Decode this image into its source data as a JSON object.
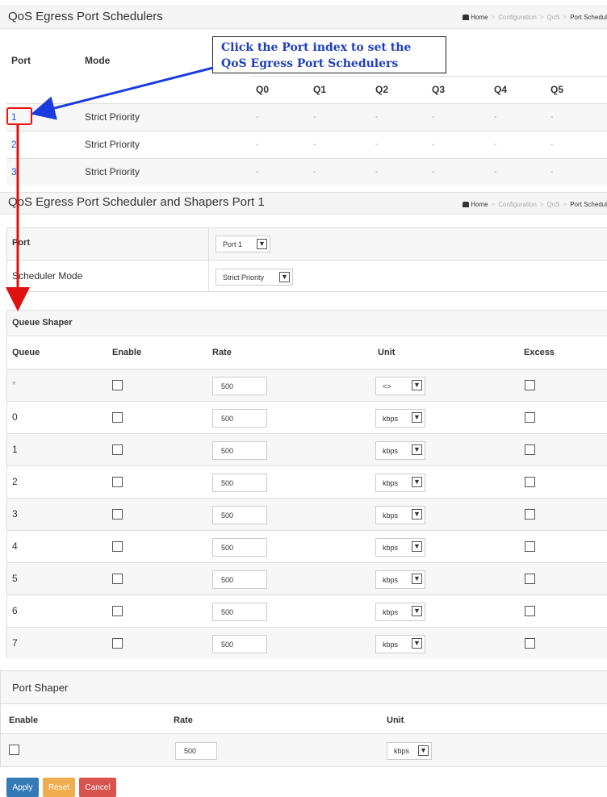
{
  "top": {
    "title": "QoS Egress Port Schedulers",
    "breadcrumb": {
      "home": "Home",
      "items": [
        "Configuration",
        "QoS"
      ],
      "current": "Port Schedul"
    }
  },
  "scheduler_table": {
    "headers": {
      "port": "Port",
      "mode": "Mode"
    },
    "queues": [
      "Q0",
      "Q1",
      "Q2",
      "Q3",
      "Q4",
      "Q5"
    ],
    "rows": [
      {
        "port": "1",
        "mode": "Strict Priority",
        "weights": [
          "-",
          "-",
          "-",
          "-",
          "-",
          "-"
        ]
      },
      {
        "port": "2",
        "mode": "Strict Priority",
        "weights": [
          "-",
          "-",
          "-",
          "-",
          "-",
          "-"
        ]
      },
      {
        "port": "3",
        "mode": "Strict Priority",
        "weights": [
          "-",
          "-",
          "-",
          "-",
          "-",
          "-"
        ]
      }
    ]
  },
  "callout": {
    "text": "Click the Port index to set the QoS Egress Port Schedulers"
  },
  "detail": {
    "title": "QoS Egress Port Scheduler and Shapers  Port 1",
    "breadcrumb": {
      "home": "Home",
      "items": [
        "Configuration",
        "QoS"
      ],
      "current": "Port Schedul"
    },
    "port_label": "Port",
    "port_value": "Port 1",
    "mode_label": "Scheduler Mode",
    "mode_value": "Strict Priority"
  },
  "queue_shaper": {
    "title": "Queue Shaper",
    "headers": {
      "queue": "Queue",
      "enable": "Enable",
      "rate": "Rate",
      "unit": "Unit",
      "excess": "Excess"
    },
    "rows": [
      {
        "queue": "*",
        "rate": "500",
        "unit": "<>"
      },
      {
        "queue": "0",
        "rate": "500",
        "unit": "kbps"
      },
      {
        "queue": "1",
        "rate": "500",
        "unit": "kbps"
      },
      {
        "queue": "2",
        "rate": "500",
        "unit": "kbps"
      },
      {
        "queue": "3",
        "rate": "500",
        "unit": "kbps"
      },
      {
        "queue": "4",
        "rate": "500",
        "unit": "kbps"
      },
      {
        "queue": "5",
        "rate": "500",
        "unit": "kbps"
      },
      {
        "queue": "6",
        "rate": "500",
        "unit": "kbps"
      },
      {
        "queue": "7",
        "rate": "500",
        "unit": "kbps"
      }
    ]
  },
  "port_shaper": {
    "title": "Port Shaper",
    "headers": {
      "enable": "Enable",
      "rate": "Rate",
      "unit": "Unit"
    },
    "rate": "500",
    "unit": "kbps"
  },
  "buttons": {
    "apply": "Apply",
    "reset": "Reset",
    "cancel": "Cancel"
  },
  "colors": {
    "apply": "#337ab7",
    "reset": "#f0ad4e",
    "cancel": "#d9534f",
    "link": "#1a5fd0",
    "callout_text": "#1f3fb8",
    "annotation_red": "#e11111",
    "annotation_blue": "#1a3be0"
  }
}
